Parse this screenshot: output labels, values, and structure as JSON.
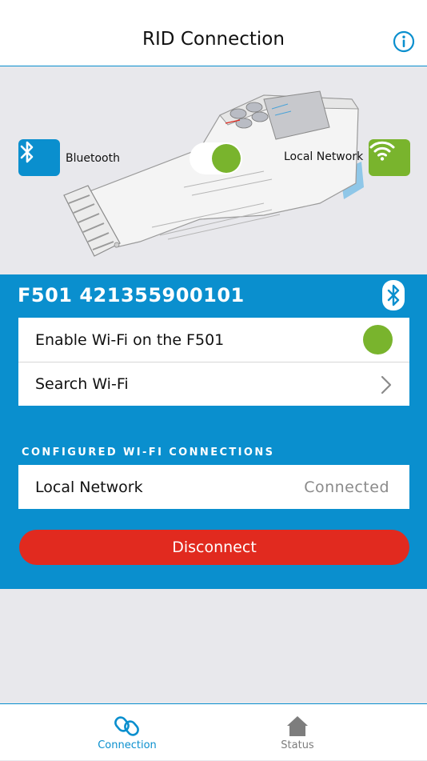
{
  "header": {
    "title": "RID Connection",
    "info_icon": "info-icon"
  },
  "hero": {
    "bluetooth_label": "Bluetooth",
    "network_label": "Local Network",
    "bluetooth_icon": "bluetooth-icon",
    "wifi_icon": "wifi-icon",
    "mode_toggle_on": true
  },
  "device": {
    "name": "F501 421355900101",
    "connection_icon": "bluetooth-icon",
    "enable_wifi_label": "Enable Wi-Fi on the F501",
    "enable_wifi_on": true,
    "search_wifi_label": "Search Wi-Fi"
  },
  "configured": {
    "header": "CONFIGURED WI-FI CONNECTIONS",
    "items": [
      {
        "name": "Local Network",
        "status": "Connected"
      }
    ]
  },
  "actions": {
    "disconnect_label": "Disconnect"
  },
  "tabbar": {
    "tabs": [
      {
        "label": "Connection",
        "icon": "link-icon",
        "active": true
      },
      {
        "label": "Status",
        "icon": "home-icon",
        "active": false
      }
    ]
  },
  "colors": {
    "accent": "#0a8fce",
    "green": "#79b42d",
    "danger": "#e12a1f",
    "background": "#e8e8ec"
  }
}
